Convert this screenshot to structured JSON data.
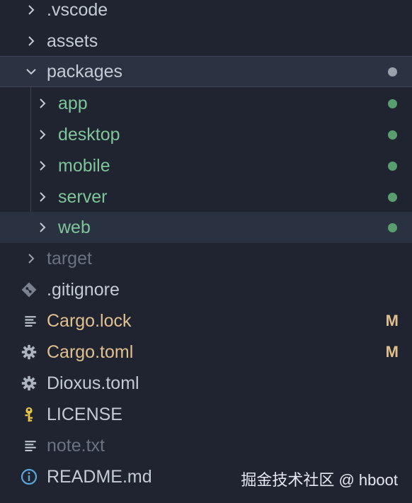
{
  "colors": {
    "background": "#1f2430",
    "default_text": "#c5cbd4",
    "untracked_green": "#7ec699",
    "modified_yellow": "#e2c08d",
    "ignored_gray": "#6b7280",
    "dot_gray": "#9aa1ad",
    "dot_green": "#5a9e70",
    "icon_gray": "#aeb4bf",
    "info_blue": "#5aa6d8",
    "key_yellow": "#e6c547",
    "git_gray": "#7a8290"
  },
  "tree": {
    "items": [
      {
        "label": ".vscode",
        "kind": "folder",
        "expanded": false
      },
      {
        "label": "assets",
        "kind": "folder",
        "expanded": false
      },
      {
        "label": "packages",
        "kind": "folder",
        "expanded": true
      },
      {
        "label": "app",
        "kind": "folder",
        "expanded": false
      },
      {
        "label": "desktop",
        "kind": "folder",
        "expanded": false
      },
      {
        "label": "mobile",
        "kind": "folder",
        "expanded": false
      },
      {
        "label": "server",
        "kind": "folder",
        "expanded": false
      },
      {
        "label": "web",
        "kind": "folder",
        "expanded": false
      },
      {
        "label": "target",
        "kind": "folder",
        "expanded": false
      },
      {
        "label": ".gitignore",
        "kind": "file",
        "icon": "git-diamond-icon"
      },
      {
        "label": "Cargo.lock",
        "kind": "file",
        "icon": "lines-file-icon",
        "badge": "M"
      },
      {
        "label": "Cargo.toml",
        "kind": "file",
        "icon": "gear-icon",
        "badge": "M"
      },
      {
        "label": "Dioxus.toml",
        "kind": "file",
        "icon": "gear-icon"
      },
      {
        "label": "LICENSE",
        "kind": "file",
        "icon": "key-icon"
      },
      {
        "label": "note.txt",
        "kind": "file",
        "icon": "lines-file-icon"
      },
      {
        "label": "README.md",
        "kind": "file",
        "icon": "info-icon"
      }
    ]
  },
  "watermark": "掘金技术社区 @ hboot"
}
